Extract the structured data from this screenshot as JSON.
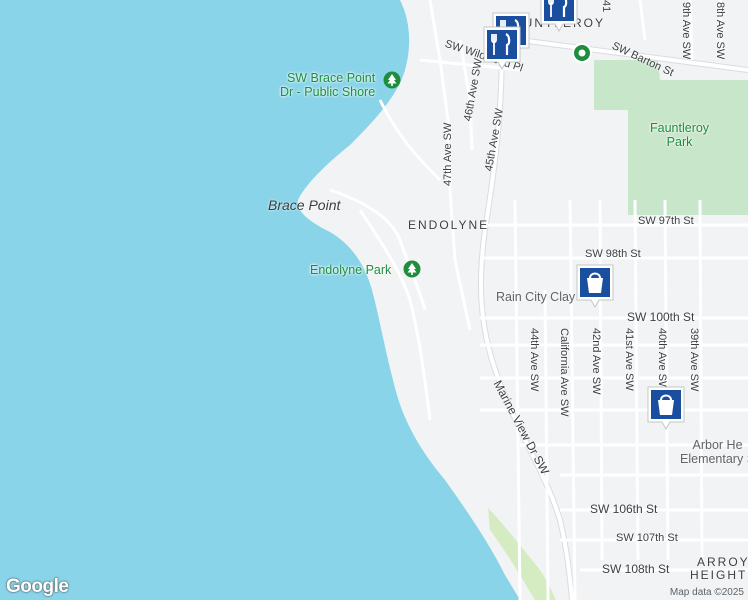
{
  "map": {
    "colors": {
      "water": "#89d4e8",
      "land": "#f1f3f4",
      "park": "#c8e6c9",
      "road": "#ffffff",
      "major_road": "#dadce0",
      "shop_pin": "#1a4fa0",
      "food_pin": "#1a4fa0",
      "park_pin": "#1e8e3e"
    },
    "streets": {
      "barton": "SW Barton St",
      "wildwood": "SW Wildwood Pl",
      "s97": "SW 97th St",
      "s98": "SW 98th St",
      "s100": "SW 100th St",
      "s106": "SW 106th St",
      "s107": "SW 107th St",
      "s108": "SW 108th St",
      "ave46": "46th Ave SW",
      "ave47": "47th Ave SW",
      "ave45": "45th Ave SW",
      "ave44": "44th Ave SW",
      "california": "California Ave SW",
      "ave42": "42nd Ave SW",
      "ave41": "41st Ave SW",
      "ave40": "40th Ave SW",
      "ave39": "39th Ave SW",
      "ave38": "8th Ave SW",
      "ave39top": "9th Ave SW",
      "ave41top": "41",
      "marine": "Marine View Dr SW"
    },
    "places": {
      "brace_point": "Brace Point",
      "endolyne": "ENDOLYNE",
      "fauntleroy_area": "FAUNTLEROY",
      "arroyo1": "ARROYO",
      "arroyo2": "HEIGHTS"
    },
    "pois": {
      "brace_shore_1": "SW Brace Point",
      "brace_shore_2": "Dr - Public Shore",
      "endolyne_park": "Endolyne Park",
      "fauntleroy_park_1": "Fauntleroy",
      "fauntleroy_park_2": "Park",
      "rain_city": "Rain City Clay",
      "arbor_1": "Arbor He",
      "arbor_2": "Elementary S"
    },
    "icons": [
      "tree-icon",
      "shopping-bag-icon",
      "fork-knife-icon",
      "park-pin-icon"
    ],
    "logo": "Google",
    "attribution": "Map data ©2025"
  }
}
